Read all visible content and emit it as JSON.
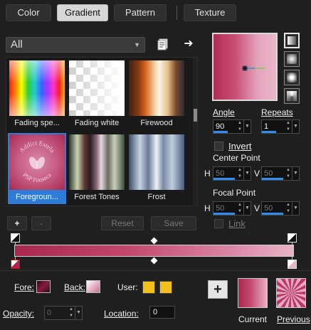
{
  "tabs": [
    {
      "label": "Color"
    },
    {
      "label": "Gradient"
    },
    {
      "label": "Pattern"
    },
    {
      "label": "Texture"
    }
  ],
  "active_tab": "Gradient",
  "category": {
    "value": "All"
  },
  "gallery": {
    "items": [
      {
        "label": "Fading spe..."
      },
      {
        "label": "Fading white"
      },
      {
        "label": "Firewood"
      },
      {
        "label": "Foregroun..."
      },
      {
        "label": "Forest Tones"
      },
      {
        "label": "Frost"
      }
    ],
    "selected": "Foregroun..."
  },
  "watermark": {
    "line1": "Addict Estela",
    "line2": "PSP Fonseca"
  },
  "list_buttons": {
    "add": "+",
    "remove": "-",
    "reset": "Reset",
    "save": "Save"
  },
  "settings": {
    "angle_label": "Angle",
    "angle_value": "90",
    "repeats_label": "Repeats",
    "repeats_value": "1",
    "invert_label": "Invert",
    "center_label": "Center Point",
    "center_h_label": "H",
    "center_h": "50",
    "center_v_label": "V",
    "center_v": "50",
    "focal_label": "Focal Point",
    "focal_h_label": "H",
    "focal_h": "50",
    "focal_v_label": "V",
    "focal_v": "50",
    "link_label": "Link"
  },
  "bottom": {
    "fore_label": "Fore:",
    "back_label": "Back:",
    "user_label": "User:",
    "opacity_label": "Opacity:",
    "opacity_value": "0",
    "location_label": "Location:",
    "location_value": "0",
    "add_button": "+",
    "current_label": "Current",
    "previous_label": "Previous"
  },
  "colors": {
    "accent": "#2f7bd8",
    "gradient_start": "#a8284e",
    "gradient_end": "#e8b4c6",
    "fore": "#8b1a3c",
    "back": "#e6b3c8",
    "user": "#f2c01a"
  },
  "icons": [
    "swatch-book-icon",
    "arrow-right-icon",
    "plus-icon",
    "minus-icon",
    "chevron-down-icon",
    "spin-arrows-icon"
  ]
}
